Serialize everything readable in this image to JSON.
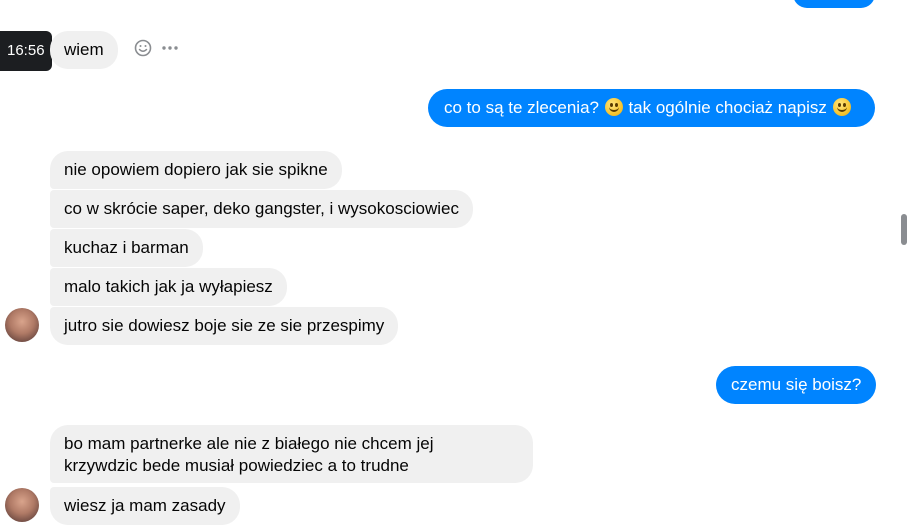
{
  "tooltip": {
    "time": "16:56"
  },
  "messages": {
    "m1": "wiem",
    "m2_part1": "co to są te zlecenia?",
    "m2_part2": "tak ogólnie chociaż napisz",
    "m3": "nie opowiem dopiero jak sie spikne",
    "m4": "co w skrócie saper, deko gangster, i wysokosciowiec",
    "m5": "kuchaz i barman",
    "m6": "malo takich jak ja  wyłapiesz",
    "m7": "jutro sie dowiesz boje sie ze sie przespimy",
    "m8": "czemu się boisz?",
    "m9_line1": "bo mam partnerke ale nie  z białego nie chcem jej",
    "m9_line2": "krzywdzic bede musiał powiedziec a to trudne",
    "m10": "wiesz ja mam zasady"
  },
  "icons": {
    "react": "smiley-reaction-icon",
    "more": "more-options-icon",
    "emoji": "slightly-smiling-face-emoji"
  },
  "colors": {
    "outgoing_bubble": "#0084ff",
    "incoming_bubble": "#f0f0f0",
    "tooltip": "#1c1e21"
  }
}
